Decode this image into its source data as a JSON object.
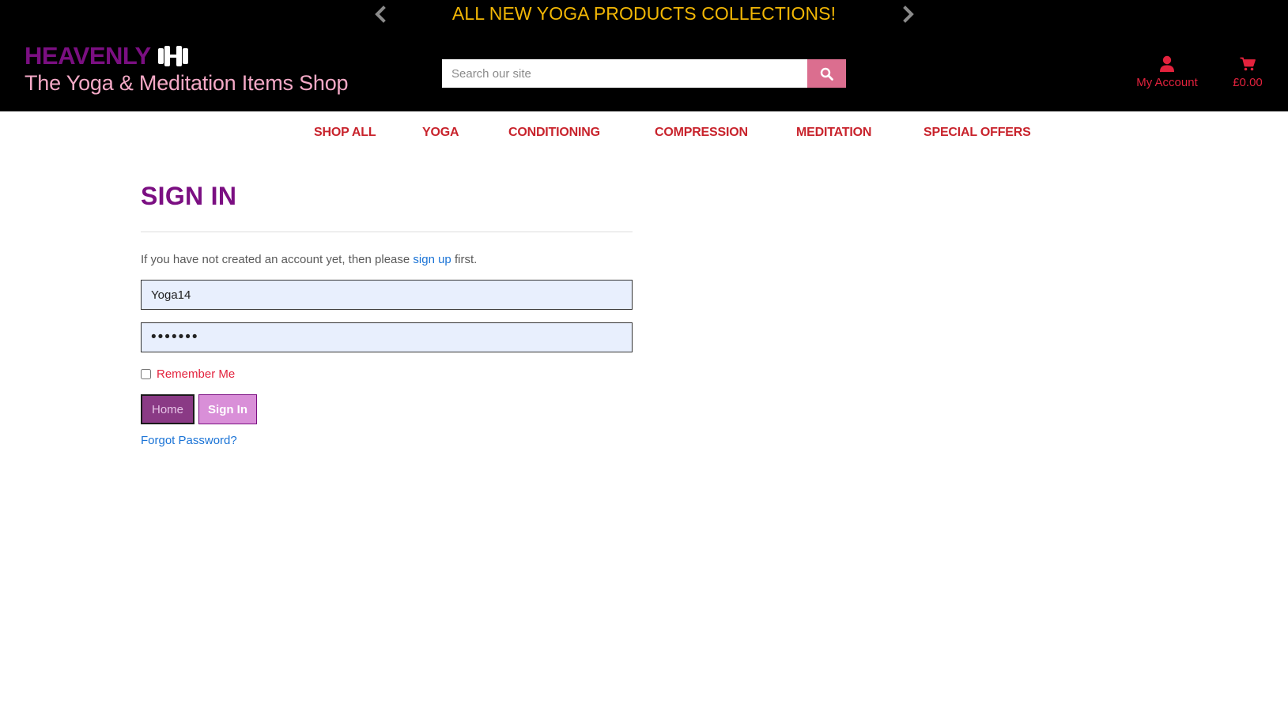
{
  "banner": {
    "text": "ALL NEW YOGA PRODUCTS COLLECTIONS!",
    "prev_icon": "chevron-left-icon",
    "next_icon": "chevron-right-icon"
  },
  "brand": {
    "name": "HEAVENLY",
    "icon": "dumbbell-icon",
    "tagline": "The Yoga & Meditation Items Shop"
  },
  "search": {
    "placeholder": "Search our site",
    "value": "",
    "icon": "search-icon"
  },
  "account": {
    "label": "My Account",
    "icon": "user-icon"
  },
  "cart": {
    "total": "£0.00",
    "icon": "shopping-cart-icon"
  },
  "nav": {
    "items": [
      {
        "label": "SHOP ALL"
      },
      {
        "label": "YOGA"
      },
      {
        "label": "CONDITIONING"
      },
      {
        "label": "COMPRESSION"
      },
      {
        "label": "MEDITATION"
      },
      {
        "label": "SPECIAL OFFERS"
      }
    ]
  },
  "signin": {
    "title": "SIGN IN",
    "intro_before": "If you have not created an account yet, then please ",
    "intro_link": "sign up",
    "intro_after": " first.",
    "username_value": "Yoga14",
    "password_value": "•••••••",
    "remember_label": "Remember Me",
    "remember_checked": false,
    "home_label": "Home",
    "signin_label": "Sign In",
    "forgot_label": "Forgot Password?"
  },
  "colors": {
    "brand_purple": "#7b0f82",
    "banner_yellow": "#f2b705",
    "accent_red": "#e3223d",
    "nav_red": "#c8232c",
    "search_button": "#db6e8f",
    "tagline_pink": "#f4a9c6",
    "link_blue": "#1a73d6"
  }
}
